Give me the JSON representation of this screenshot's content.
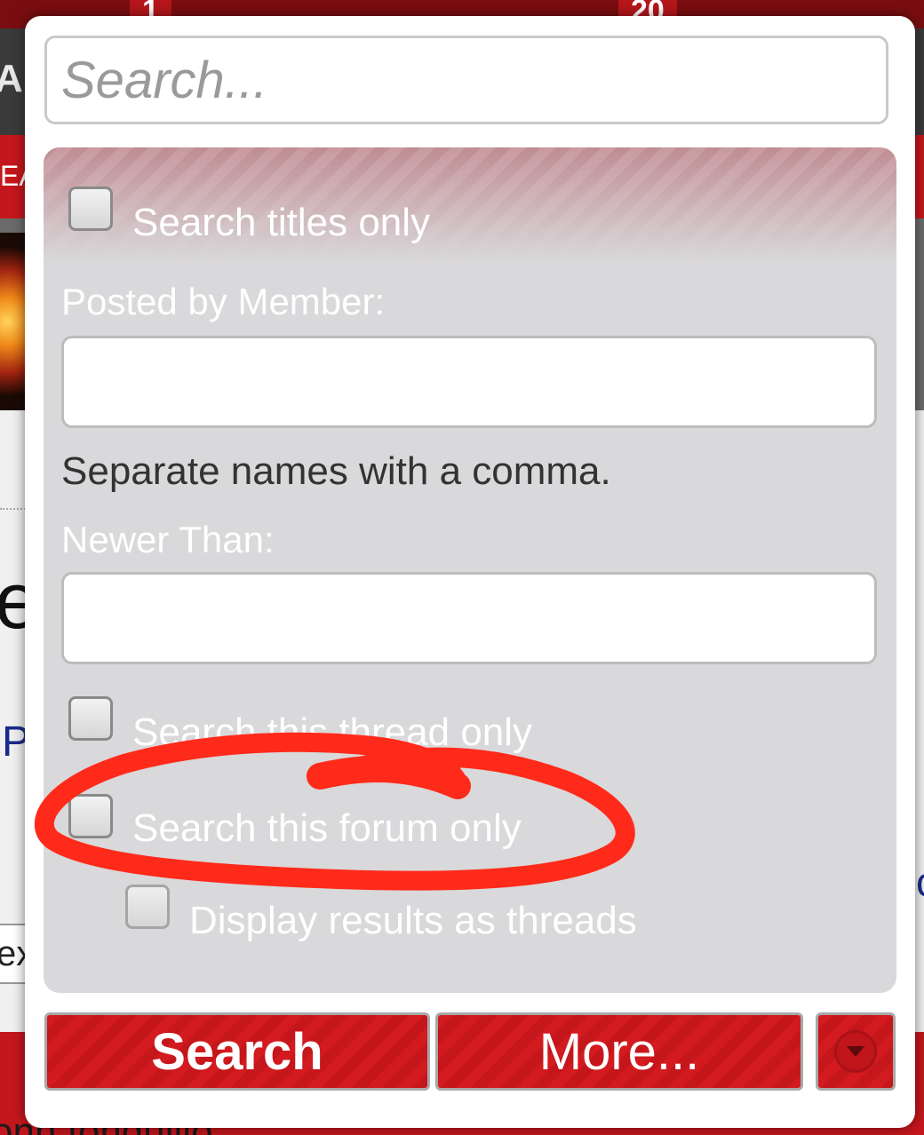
{
  "background": {
    "badge_left": "1",
    "badge_right": "20",
    "dark_bar_fragment": "Ar",
    "red_bar_fragment": "EA",
    "letter_e": "e",
    "letter_p": "P",
    "letter_c": "c",
    "input_fragment": "ex",
    "bottom_fragment": "onn fonduillo"
  },
  "search": {
    "placeholder": "Search..."
  },
  "options": {
    "titles_only": "Search titles only",
    "posted_by_label": "Posted by Member:",
    "posted_by_value": "",
    "separate_hint": "Separate names with a comma.",
    "newer_than_label": "Newer Than:",
    "newer_than_value": "",
    "thread_only": "Search this thread only",
    "forum_only": "Search this forum only",
    "display_threads": "Display results as threads"
  },
  "buttons": {
    "search": "Search",
    "more": "More...",
    "dropdown_icon": "chevron-down-circle-icon"
  },
  "colors": {
    "accent_red": "#c4171d",
    "annotation_red": "#ff2a1a",
    "panel_gray": "#d9d8da"
  }
}
